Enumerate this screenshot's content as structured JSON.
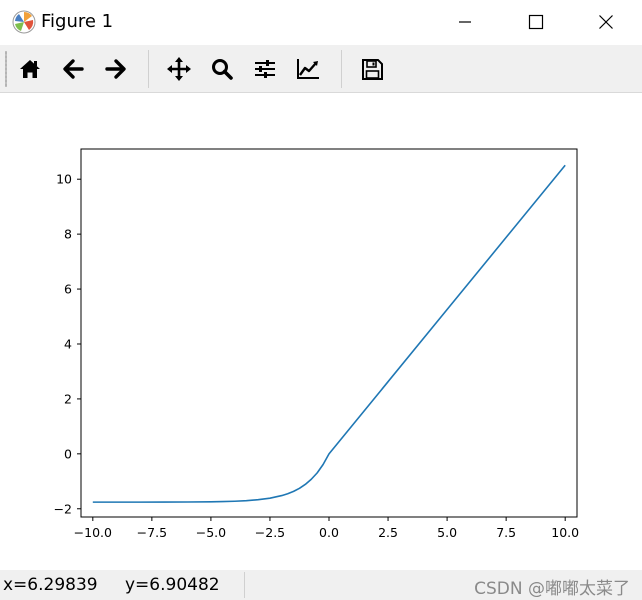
{
  "window": {
    "title": "Figure 1",
    "controls": [
      "minimize-icon",
      "maximize-icon",
      "close-icon"
    ]
  },
  "toolbar": {
    "buttons": [
      {
        "icon": "home-icon"
      },
      {
        "icon": "back-arrow-icon"
      },
      {
        "icon": "forward-arrow-icon"
      },
      {
        "icon": "pan-icon"
      },
      {
        "icon": "zoom-icon"
      },
      {
        "icon": "subplots-icon"
      },
      {
        "icon": "edit-axis-icon"
      },
      {
        "icon": "save-icon"
      }
    ]
  },
  "statusbar": {
    "x_readout": "x=6.29839",
    "y_readout": "y=6.90482",
    "watermark": "CSDN @嘟嘟太菜了"
  },
  "colors": {
    "line": "#1f77b4",
    "toolbar_bg": "#f0f0f0",
    "watermark": "#8a8a8a"
  },
  "chart_data": {
    "type": "line",
    "title": "",
    "xlabel": "",
    "ylabel": "",
    "xlim": [
      -10.5,
      10.5
    ],
    "ylim": [
      -2.3,
      11.1
    ],
    "xticks": [
      -10.0,
      -7.5,
      -5.0,
      -2.5,
      0.0,
      2.5,
      5.0,
      7.5,
      10.0
    ],
    "xtick_labels": [
      "−10.0",
      "−7.5",
      "−5.0",
      "−2.5",
      "0.0",
      "2.5",
      "5.0",
      "7.5",
      "10.0"
    ],
    "yticks": [
      -2,
      0,
      2,
      4,
      6,
      8,
      10
    ],
    "ytick_labels": [
      "−2",
      "0",
      "2",
      "4",
      "6",
      "8",
      "10"
    ],
    "grid": false,
    "series": [
      {
        "x": [
          -10,
          -9,
          -8,
          -7,
          -6,
          -5,
          -4.5,
          -4,
          -3.5,
          -3,
          -2.5,
          -2,
          -1.75,
          -1.5,
          -1.25,
          -1,
          -0.75,
          -0.5,
          -0.25,
          0,
          2.5,
          5,
          7.5,
          10
        ],
        "y": [
          -1.758,
          -1.758,
          -1.758,
          -1.757,
          -1.754,
          -1.746,
          -1.739,
          -1.726,
          -1.705,
          -1.67,
          -1.614,
          -1.52,
          -1.453,
          -1.367,
          -1.255,
          -1.111,
          -0.926,
          -0.693,
          -0.389,
          0.0,
          2.627,
          5.254,
          7.881,
          10.507
        ]
      }
    ]
  }
}
